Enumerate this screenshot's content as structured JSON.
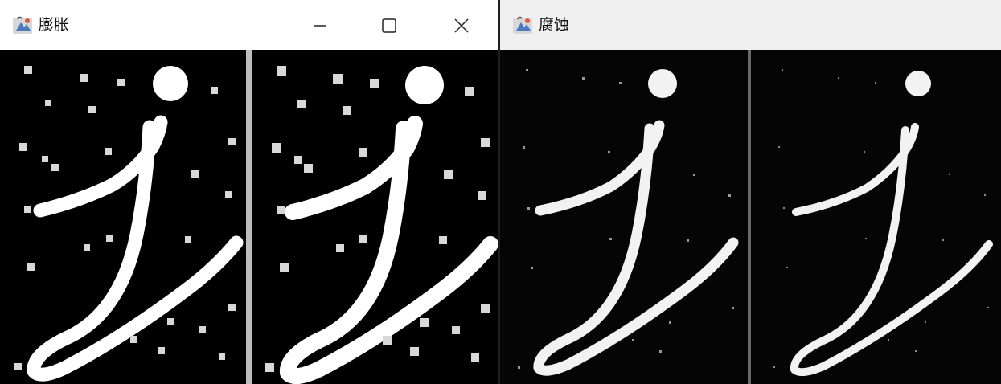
{
  "windows": [
    {
      "title": "膨胀",
      "controls": {
        "minimize": "minimize-icon",
        "maximize": "maximize-icon",
        "close": "close-icon"
      },
      "image_panels": 2
    },
    {
      "title": "腐蚀",
      "image_panels": 2
    }
  ],
  "colors": {
    "titlebar_active": "#ffffff",
    "titlebar_inactive": "#f0f0f0",
    "image_bg": "#000000",
    "glyph": "#ffffff",
    "separator": "#bdbdbd"
  }
}
